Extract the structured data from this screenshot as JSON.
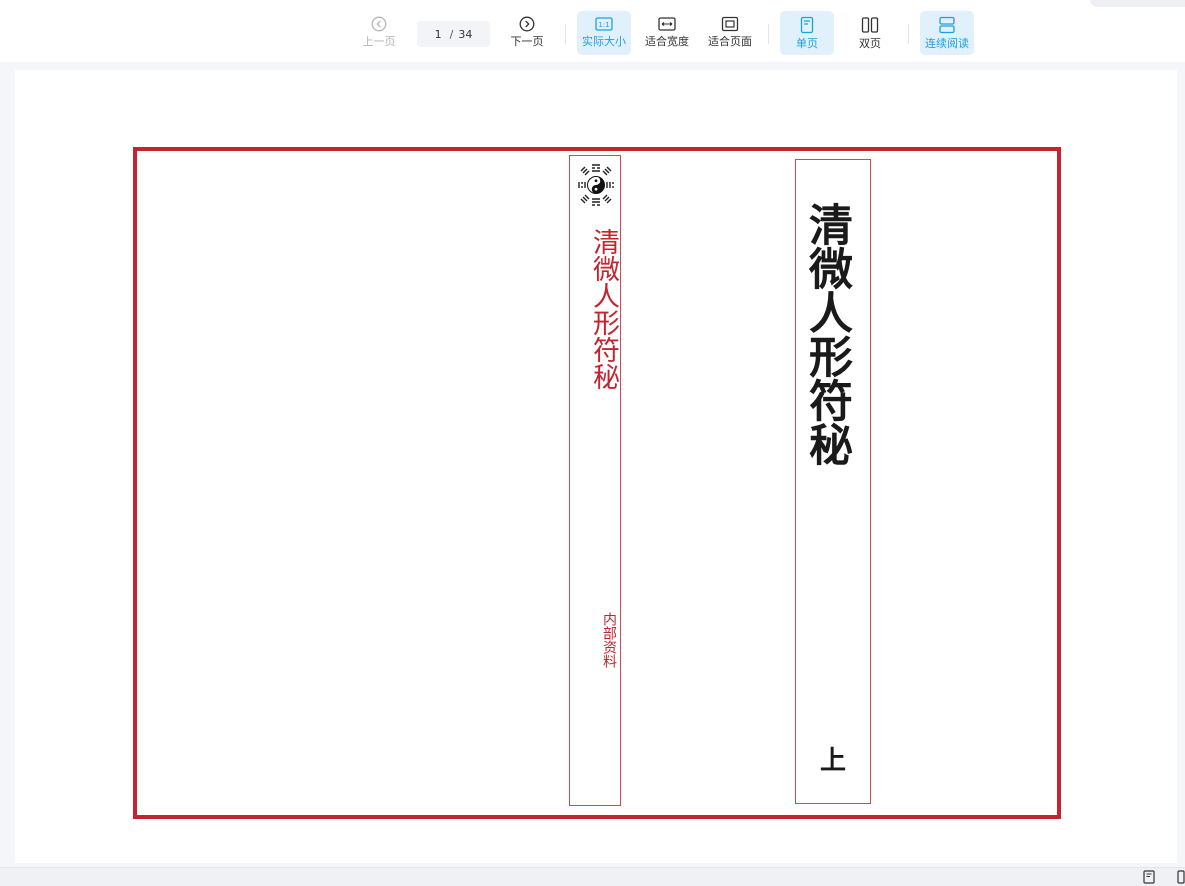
{
  "toolbar": {
    "prev_label": "上一页",
    "next_label": "下一页",
    "page_current": "1",
    "page_total": "34",
    "actual_size_label": "实际大小",
    "fit_width_label": "适合宽度",
    "fit_page_label": "适合页面",
    "single_page_label": "单页",
    "double_page_label": "双页",
    "continuous_label": "连续阅读",
    "actual_size_icon_text": "1:1"
  },
  "document": {
    "spine_title": "清微人形符秘",
    "spine_subtitle": "内部资料",
    "cover_title": "清微人形符秘",
    "cover_volume": "上"
  },
  "colors": {
    "accent": "#1e9fe0",
    "active_bg": "#e1f1fb",
    "cover_red": "#c4242f"
  },
  "icons": {
    "spine_emblem": "taiji-bagua-icon"
  }
}
